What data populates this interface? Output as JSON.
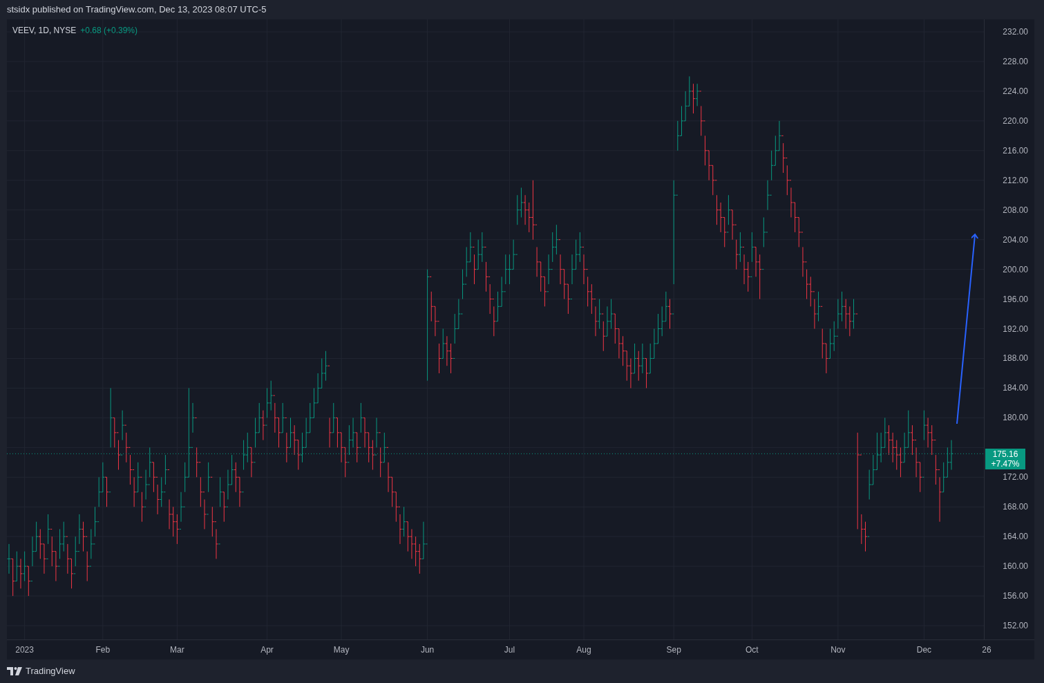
{
  "header": {
    "text": "stsidx published on TradingView.com, Dec 13, 2023 08:07 UTC-5"
  },
  "legend": {
    "symbol": "VEEV, 1D, NYSE",
    "change": "+0.68 (+0.39%)"
  },
  "last_price": {
    "price": "175.16",
    "change": "+7.47%"
  },
  "price_axis": {
    "labels": [
      "232.00",
      "228.00",
      "224.00",
      "220.00",
      "216.00",
      "212.00",
      "208.00",
      "204.00",
      "200.00",
      "196.00",
      "192.00",
      "188.00",
      "184.00",
      "180.00",
      "172.00",
      "168.00",
      "164.00",
      "160.00",
      "156.00",
      "152.00"
    ]
  },
  "time_axis": {
    "labels": [
      "2023",
      "Feb",
      "Mar",
      "Apr",
      "May",
      "Jun",
      "Jul",
      "Aug",
      "Sep",
      "Oct",
      "Nov",
      "Dec",
      "26"
    ]
  },
  "footer": {
    "brand": "TradingView"
  }
}
